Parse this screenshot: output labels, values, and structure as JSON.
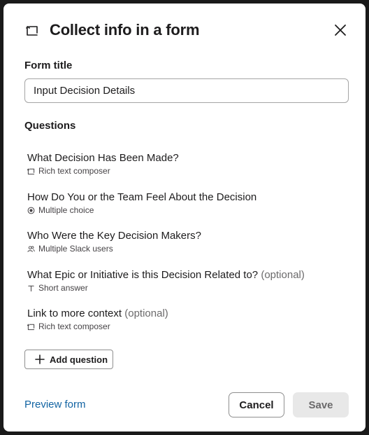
{
  "header": {
    "title": "Collect info in a form",
    "icon": "form-icon",
    "close_icon": "close-icon"
  },
  "form_title": {
    "label": "Form title",
    "value": "Input Decision Details"
  },
  "questions": {
    "label": "Questions",
    "items": [
      {
        "title": "What Decision Has Been Made?",
        "optional": "",
        "type": "Rich text composer",
        "icon": "rich-text-icon"
      },
      {
        "title": "How Do You or the Team Feel About the Decision",
        "optional": "",
        "type": "Multiple choice",
        "icon": "radio-icon"
      },
      {
        "title": "Who Were the Key Decision Makers?",
        "optional": "",
        "type": "Multiple Slack users",
        "icon": "users-icon"
      },
      {
        "title": "What Epic or Initiative is this Decision Related to?",
        "optional": "(optional)",
        "type": "Short answer",
        "icon": "text-icon"
      },
      {
        "title": "Link to more context",
        "optional": "(optional)",
        "type": "Rich text composer",
        "icon": "rich-text-icon"
      }
    ]
  },
  "add_question": {
    "label": "Add question",
    "icon": "plus-icon"
  },
  "footer": {
    "preview_label": "Preview form",
    "cancel_label": "Cancel",
    "save_label": "Save"
  },
  "colors": {
    "link": "#1264a3",
    "text": "#1d1c1d",
    "muted": "#6b6a6b",
    "save_bg": "#e8e8e8"
  }
}
